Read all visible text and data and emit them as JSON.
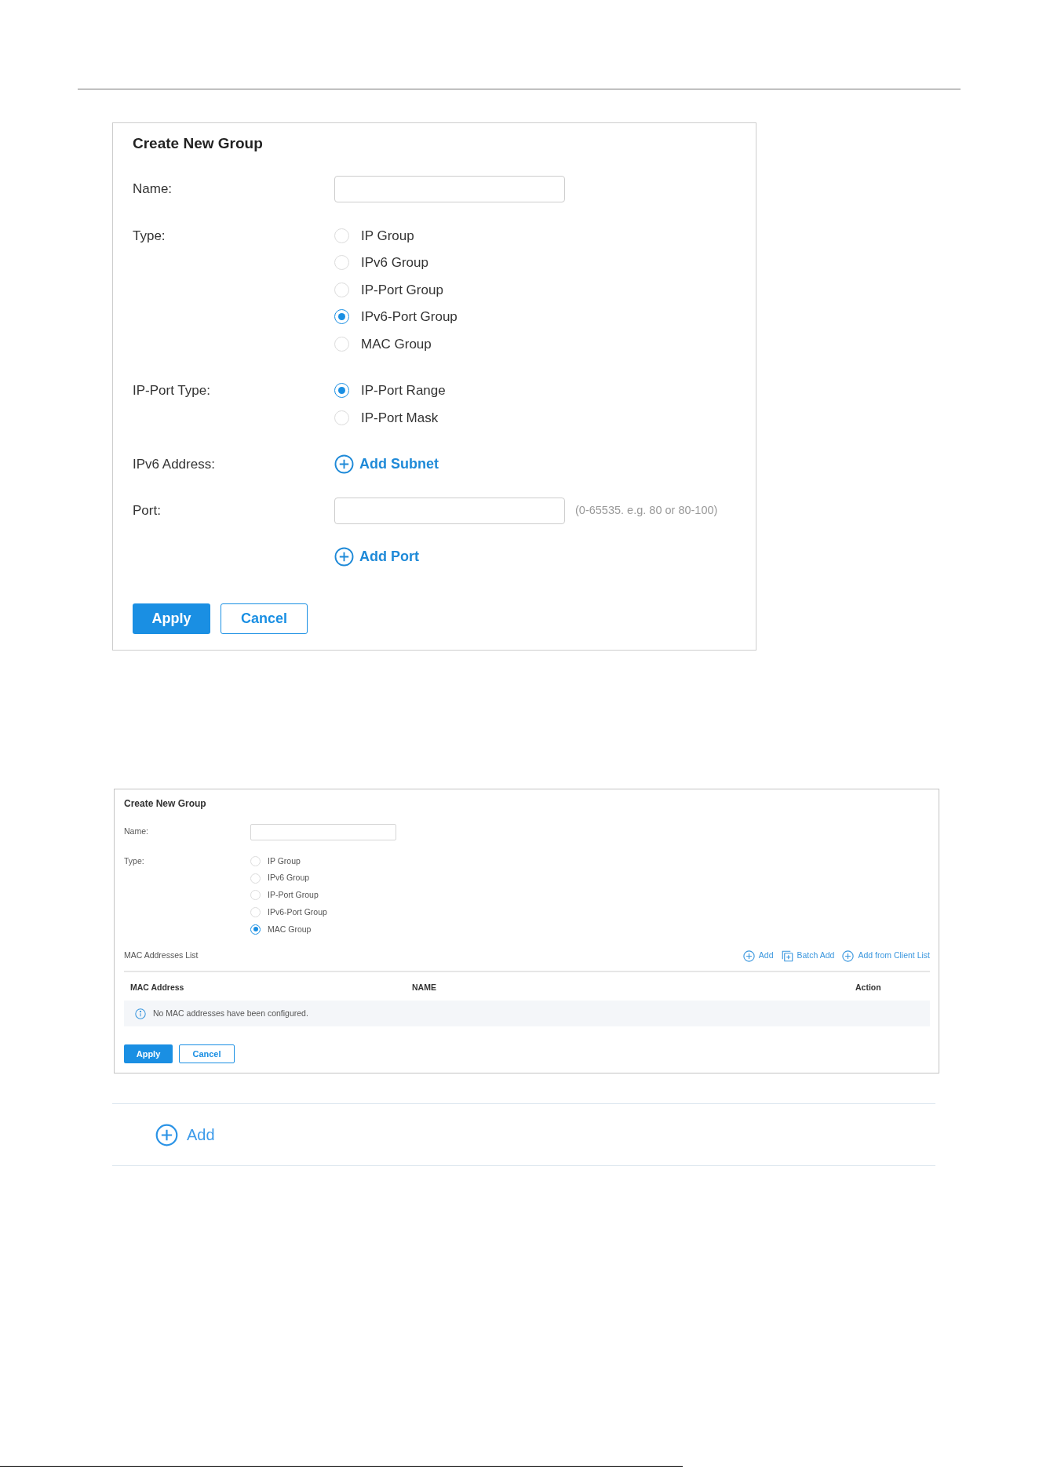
{
  "forms": [
    {
      "title": "Create New Group",
      "rows": [
        {
          "kind": "text_input",
          "label": "Name:"
        },
        {
          "kind": "radio_group",
          "label": "Type:",
          "options": [
            {
              "label": "IP Group",
              "selected": false
            },
            {
              "label": "IPv6 Group",
              "selected": false
            },
            {
              "label": "IP-Port Group",
              "selected": false
            },
            {
              "label": "IPv6-Port Group",
              "selected": true
            },
            {
              "label": "MAC Group",
              "selected": false
            }
          ]
        },
        {
          "kind": "radio_group",
          "label": "IP-Port Type:",
          "options": [
            {
              "label": "IP-Port Range",
              "selected": true
            },
            {
              "label": "IP-Port Mask",
              "selected": false
            }
          ]
        },
        {
          "kind": "link",
          "label": "IPv6 Address:",
          "link": "Add Subnet"
        },
        {
          "kind": "text_input",
          "label": "Port:",
          "hint": "(0-65535. e.g. 80 or 80-100)"
        },
        {
          "kind": "link",
          "link": "Add Port"
        }
      ],
      "buttons": [
        {
          "kind": "primary",
          "label": "Apply"
        },
        {
          "kind": "secondary",
          "label": "Cancel"
        }
      ]
    },
    {
      "title": "Create New Group",
      "rows": [
        {
          "kind": "text_input",
          "label": "Name:"
        },
        {
          "kind": "radio_group",
          "label": "Type:",
          "options": [
            {
              "label": "IP Group",
              "selected": false
            },
            {
              "label": "IPv6 Group",
              "selected": false
            },
            {
              "label": "IP-Port Group",
              "selected": false
            },
            {
              "label": "IPv6-Port Group",
              "selected": false
            },
            {
              "label": "MAC Group",
              "selected": true
            }
          ]
        }
      ],
      "list": {
        "title": "MAC Addresses List",
        "actions": [
          {
            "kind": "add",
            "label": "Add"
          },
          {
            "kind": "batch",
            "label": "Batch Add"
          },
          {
            "kind": "add",
            "label": "Add from Client List"
          }
        ],
        "columns": [
          "MAC Address",
          "NAME",
          "Action"
        ],
        "empty_message": "No MAC addresses have been configured."
      },
      "buttons": [
        {
          "kind": "primary",
          "label": "Apply"
        },
        {
          "kind": "secondary",
          "label": "Cancel"
        }
      ]
    }
  ],
  "add_bar": {
    "label": "Add"
  }
}
